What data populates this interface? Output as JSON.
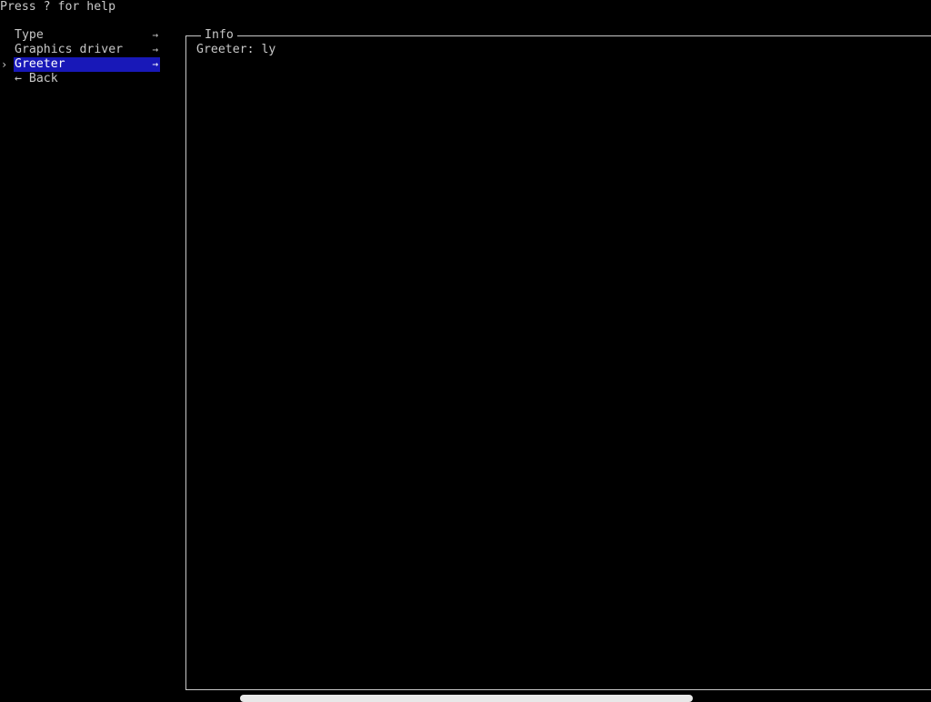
{
  "help_text": "Press ? for help",
  "menu": {
    "items": [
      {
        "label": "Type",
        "arrow": "→"
      },
      {
        "label": "Graphics driver",
        "arrow": "→"
      },
      {
        "label": "Greeter",
        "arrow": "→"
      },
      {
        "label": "← Back",
        "arrow": ""
      }
    ],
    "cursor": "›"
  },
  "info": {
    "title": "Info",
    "content": "Greeter: ly"
  },
  "colors": {
    "selection_bg": "#1818b8",
    "text": "#c8c8c8",
    "background": "#000000"
  }
}
